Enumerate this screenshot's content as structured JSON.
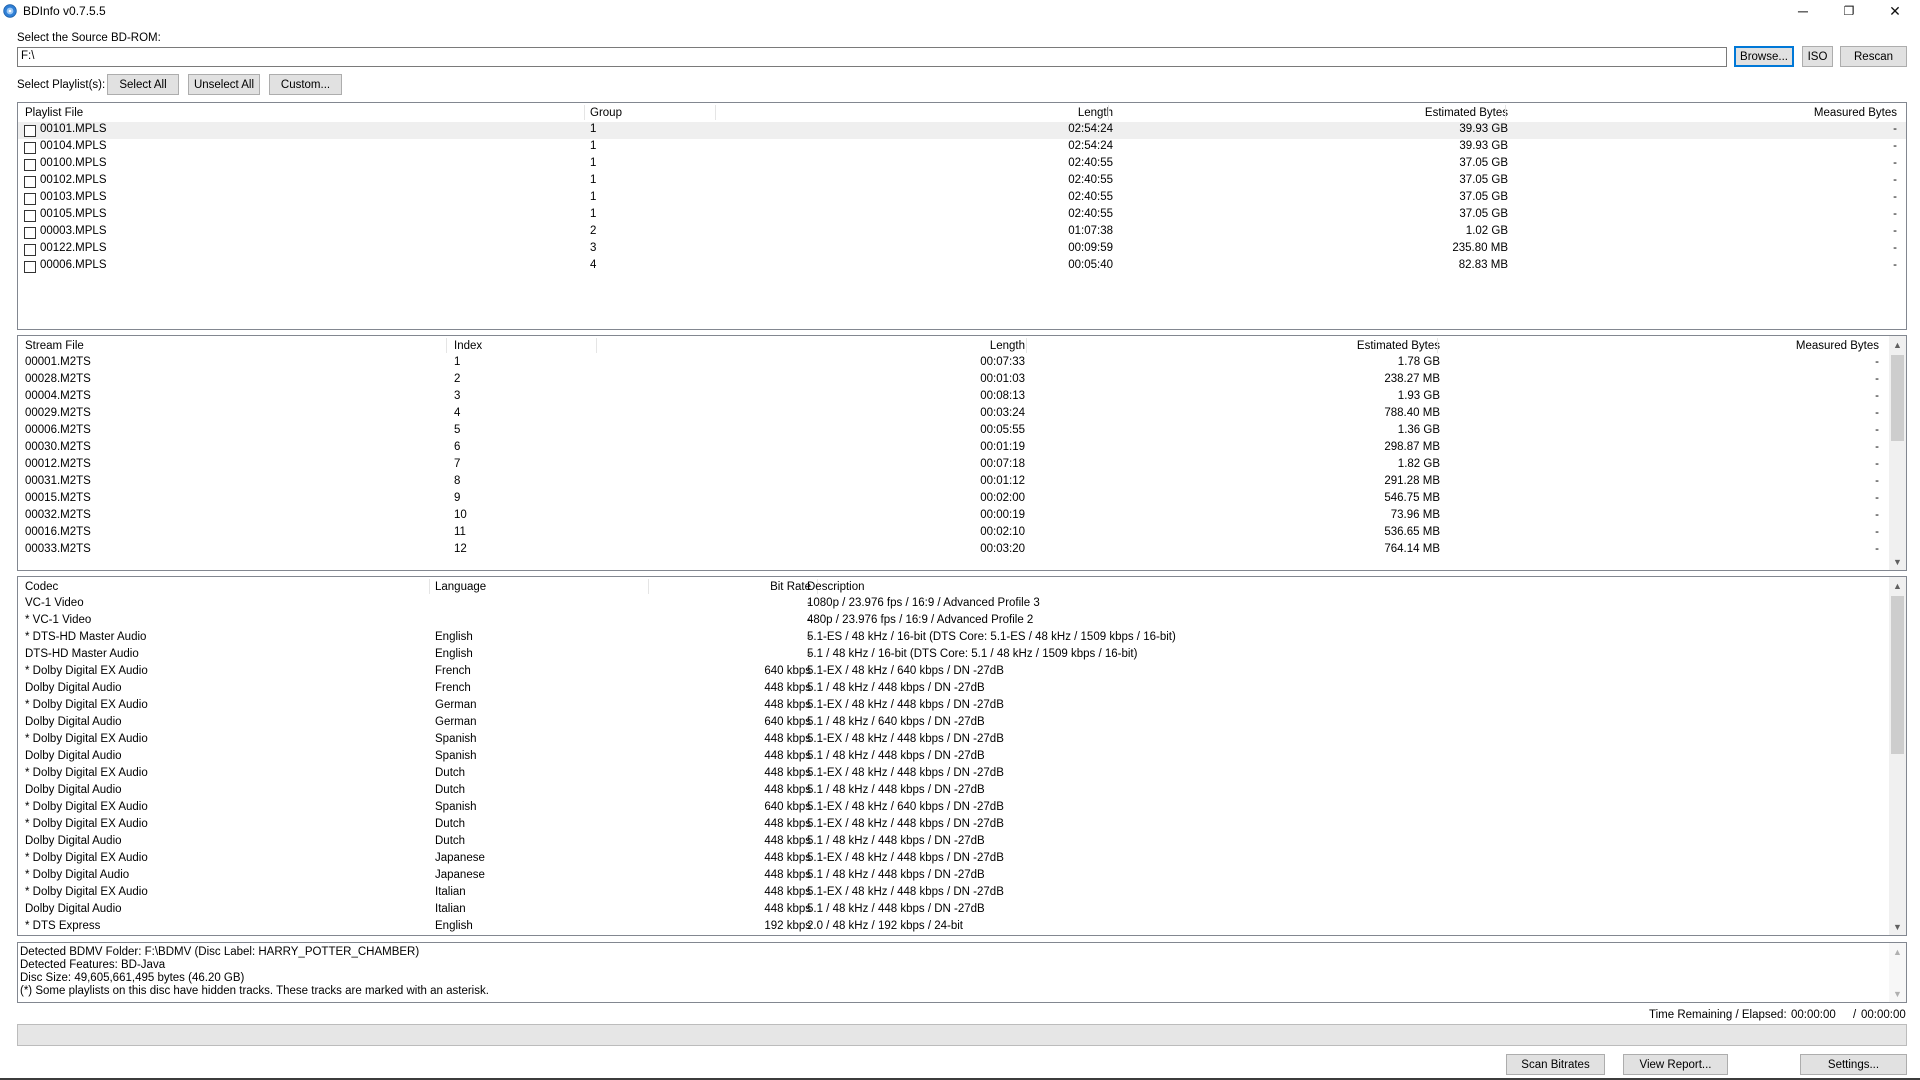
{
  "window": {
    "title": "BDInfo v0.7.5.5",
    "controls": {
      "minimize": "─",
      "maximize": "❐",
      "close": "✕"
    }
  },
  "source": {
    "label": "Select the Source BD-ROM:",
    "path": "F:\\",
    "browse_label": "Browse...",
    "iso_label": "ISO",
    "rescan_label": "Rescan"
  },
  "playlist_select": {
    "label": "Select Playlist(s):",
    "select_all": "Select All",
    "unselect_all": "Unselect All",
    "custom": "Custom..."
  },
  "playlists": {
    "headers": [
      "Playlist File",
      "Group",
      "Length",
      "Estimated Bytes",
      "Measured Bytes"
    ],
    "rows": [
      [
        "00101.MPLS",
        "1",
        "02:54:24",
        "39.93 GB",
        "-"
      ],
      [
        "00104.MPLS",
        "1",
        "02:54:24",
        "39.93 GB",
        "-"
      ],
      [
        "00100.MPLS",
        "1",
        "02:40:55",
        "37.05 GB",
        "-"
      ],
      [
        "00102.MPLS",
        "1",
        "02:40:55",
        "37.05 GB",
        "-"
      ],
      [
        "00103.MPLS",
        "1",
        "02:40:55",
        "37.05 GB",
        "-"
      ],
      [
        "00105.MPLS",
        "1",
        "02:40:55",
        "37.05 GB",
        "-"
      ],
      [
        "00003.MPLS",
        "2",
        "01:07:38",
        "1.02 GB",
        "-"
      ],
      [
        "00122.MPLS",
        "3",
        "00:09:59",
        "235.80 MB",
        "-"
      ],
      [
        "00006.MPLS",
        "4",
        "00:05:40",
        "82.83 MB",
        "-"
      ]
    ]
  },
  "streams": {
    "headers": [
      "Stream File",
      "Index",
      "Length",
      "Estimated Bytes",
      "Measured Bytes"
    ],
    "rows": [
      [
        "00001.M2TS",
        "1",
        "00:07:33",
        "1.78 GB",
        "-"
      ],
      [
        "00028.M2TS",
        "2",
        "00:01:03",
        "238.27 MB",
        "-"
      ],
      [
        "00004.M2TS",
        "3",
        "00:08:13",
        "1.93 GB",
        "-"
      ],
      [
        "00029.M2TS",
        "4",
        "00:03:24",
        "788.40 MB",
        "-"
      ],
      [
        "00006.M2TS",
        "5",
        "00:05:55",
        "1.36 GB",
        "-"
      ],
      [
        "00030.M2TS",
        "6",
        "00:01:19",
        "298.87 MB",
        "-"
      ],
      [
        "00012.M2TS",
        "7",
        "00:07:18",
        "1.82 GB",
        "-"
      ],
      [
        "00031.M2TS",
        "8",
        "00:01:12",
        "291.28 MB",
        "-"
      ],
      [
        "00015.M2TS",
        "9",
        "00:02:00",
        "546.75 MB",
        "-"
      ],
      [
        "00032.M2TS",
        "10",
        "00:00:19",
        "73.96 MB",
        "-"
      ],
      [
        "00016.M2TS",
        "11",
        "00:02:10",
        "536.65 MB",
        "-"
      ],
      [
        "00033.M2TS",
        "12",
        "00:03:20",
        "764.14 MB",
        "-"
      ]
    ]
  },
  "codecs": {
    "headers": [
      "Codec",
      "Language",
      "Bit Rate",
      "Description"
    ],
    "rows": [
      [
        "VC-1 Video",
        "",
        "-",
        "1080p / 23.976 fps / 16:9 / Advanced Profile 3"
      ],
      [
        "* VC-1 Video",
        "",
        "-",
        "480p / 23.976 fps / 16:9 / Advanced Profile 2"
      ],
      [
        "* DTS-HD Master Audio",
        "English",
        "-",
        "5.1-ES / 48 kHz / 16-bit (DTS Core: 5.1-ES / 48 kHz /  1509 kbps / 16-bit)"
      ],
      [
        "DTS-HD Master Audio",
        "English",
        "-",
        "5.1 / 48 kHz / 16-bit (DTS Core: 5.1 / 48 kHz /  1509 kbps / 16-bit)"
      ],
      [
        "* Dolby Digital EX Audio",
        "French",
        "640 kbps",
        "5.1-EX / 48 kHz /   640 kbps / DN -27dB"
      ],
      [
        "Dolby Digital Audio",
        "French",
        "448 kbps",
        "5.1 / 48 kHz /   448 kbps / DN -27dB"
      ],
      [
        "* Dolby Digital EX Audio",
        "German",
        "448 kbps",
        "5.1-EX / 48 kHz /   448 kbps / DN -27dB"
      ],
      [
        "Dolby Digital Audio",
        "German",
        "640 kbps",
        "5.1 / 48 kHz /   640 kbps / DN -27dB"
      ],
      [
        "* Dolby Digital EX Audio",
        "Spanish",
        "448 kbps",
        "5.1-EX / 48 kHz /   448 kbps / DN -27dB"
      ],
      [
        "Dolby Digital Audio",
        "Spanish",
        "448 kbps",
        "5.1 / 48 kHz /   448 kbps / DN -27dB"
      ],
      [
        "* Dolby Digital EX Audio",
        "Dutch",
        "448 kbps",
        "5.1-EX / 48 kHz /   448 kbps / DN -27dB"
      ],
      [
        "Dolby Digital Audio",
        "Dutch",
        "448 kbps",
        "5.1 / 48 kHz /   448 kbps / DN -27dB"
      ],
      [
        "* Dolby Digital EX Audio",
        "Spanish",
        "640 kbps",
        "5.1-EX / 48 kHz /   640 kbps / DN -27dB"
      ],
      [
        "* Dolby Digital EX Audio",
        "Dutch",
        "448 kbps",
        "5.1-EX / 48 kHz /   448 kbps / DN -27dB"
      ],
      [
        "Dolby Digital Audio",
        "Dutch",
        "448 kbps",
        "5.1 / 48 kHz /   448 kbps / DN -27dB"
      ],
      [
        "* Dolby Digital EX Audio",
        "Japanese",
        "448 kbps",
        "5.1-EX / 48 kHz /   448 kbps / DN -27dB"
      ],
      [
        "* Dolby Digital Audio",
        "Japanese",
        "448 kbps",
        "5.1 / 48 kHz /   448 kbps / DN -27dB"
      ],
      [
        "* Dolby Digital EX Audio",
        "Italian",
        "448 kbps",
        "5.1-EX / 48 kHz /   448 kbps / DN -27dB"
      ],
      [
        "Dolby Digital Audio",
        "Italian",
        "448 kbps",
        "5.1 / 48 kHz /   448 kbps / DN -27dB"
      ],
      [
        "* DTS Express",
        "English",
        "192 kbps",
        "2.0 / 48 kHz /   192 kbps / 24-bit"
      ]
    ]
  },
  "status": {
    "lines": [
      "Detected BDMV Folder: F:\\BDMV (Disc Label: HARRY_POTTER_CHAMBER)",
      "Detected Features: BD-Java",
      "Disc Size: 49,605,661,495 bytes (46.20 GB)",
      "(*) Some playlists on this disc have hidden tracks. These tracks are marked with an asterisk."
    ]
  },
  "timer": {
    "label": "Time Remaining / Elapsed:",
    "remaining": "00:00:00",
    "separator": "/",
    "elapsed": "00:00:00"
  },
  "progress": {
    "value": 0
  },
  "actions": {
    "scan_bitrates": "Scan Bitrates",
    "view_report": "View Report...",
    "settings": "Settings..."
  },
  "colors": {
    "focus": "#0078d7",
    "button": "#e1e1e1",
    "selected_row": "#efefef"
  },
  "icons": {
    "app": "disc-icon",
    "scroll_up": "chevron-up-icon",
    "scroll_down": "chevron-down-icon"
  }
}
